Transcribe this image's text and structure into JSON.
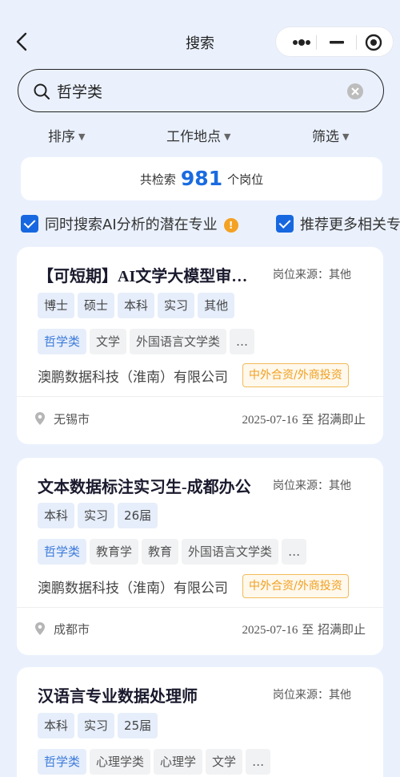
{
  "header": {
    "title": "搜索"
  },
  "search": {
    "query": "哲学类"
  },
  "filters": {
    "sort": "排序",
    "location": "工作地点",
    "filter": "筛选"
  },
  "result": {
    "prefix": "共检索",
    "count": "981",
    "suffix": "个岗位"
  },
  "options": {
    "ai_major": "同时搜索AI分析的潜在专业",
    "more_related": "推荐更多相关专"
  },
  "jobs": [
    {
      "title": "【可短期】AI文学大模型审…",
      "source": "岗位来源：其他",
      "edu_tags": [
        "博士",
        "硕士",
        "本科",
        "实习",
        "其他"
      ],
      "major_highlight": "哲学类",
      "major_tags": [
        "文学",
        "外国语言文学类",
        "…"
      ],
      "company": "澳鹏数据科技（淮南）有限公司",
      "company_type": "中外合资/外商投资",
      "city": "无锡市",
      "date": "2025-07-16",
      "deadline": "至 招满即止"
    },
    {
      "title": "文本数据标注实习生-成都办公",
      "source": "岗位来源：其他",
      "edu_tags": [
        "本科",
        "实习",
        "26届"
      ],
      "major_highlight": "哲学类",
      "major_tags": [
        "教育学",
        "教育",
        "外国语言文学类",
        "…"
      ],
      "company": "澳鹏数据科技（淮南）有限公司",
      "company_type": "中外合资/外商投资",
      "city": "成都市",
      "date": "2025-07-16",
      "deadline": "至 招满即止"
    },
    {
      "title": "汉语言专业数据处理师",
      "source": "岗位来源：其他",
      "edu_tags": [
        "本科",
        "实习",
        "25届"
      ],
      "major_highlight": "哲学类",
      "major_tags": [
        "心理学类",
        "心理学",
        "文学",
        "…"
      ]
    }
  ],
  "icons": {
    "back": "chevron-left-icon",
    "more": "more-dots-icon",
    "minimize": "minimize-icon",
    "close": "target-circle-icon",
    "search": "search-icon",
    "clear": "clear-icon",
    "info": "info-icon",
    "location": "location-pin-icon"
  },
  "colors": {
    "accent": "#1768e0",
    "count": "#1a6be0",
    "warning": "#f0a021",
    "background": "#eaf1fd"
  }
}
